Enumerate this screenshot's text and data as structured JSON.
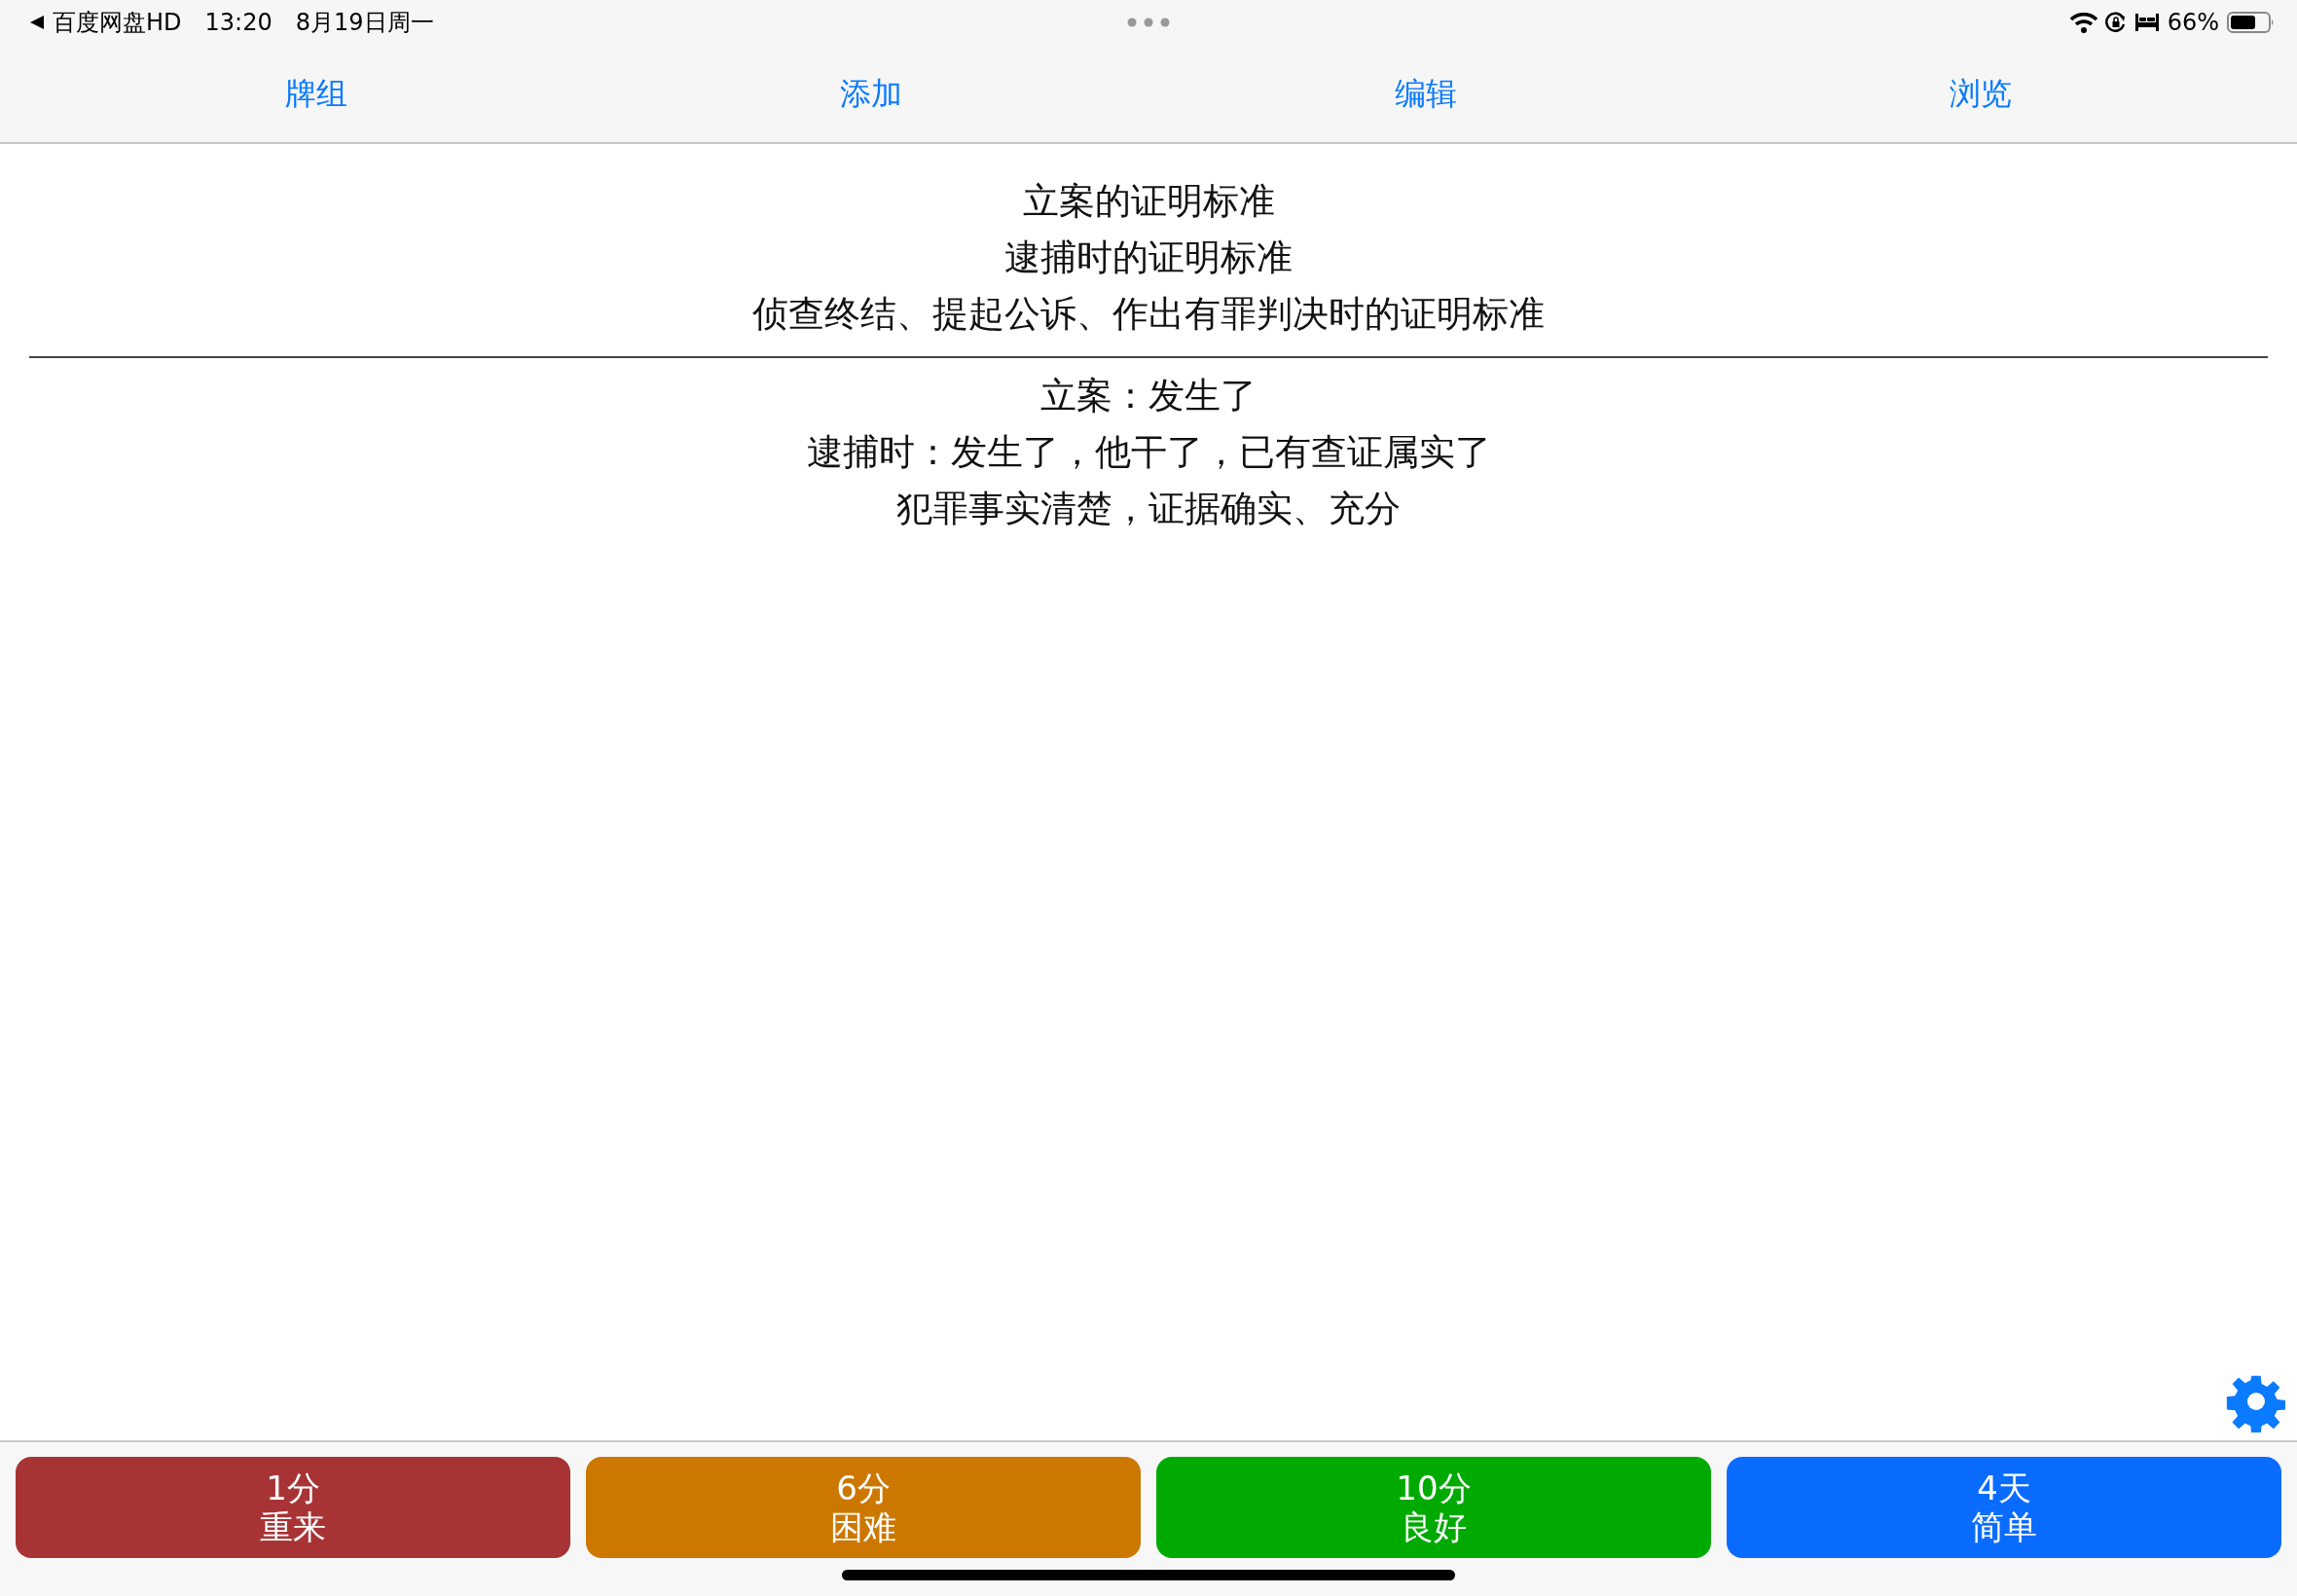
{
  "status_bar": {
    "back_app": "百度网盘HD",
    "time": "13:20",
    "date": "8月19日周一",
    "battery_percent": "66%"
  },
  "tabs": [
    {
      "label": "牌组"
    },
    {
      "label": "添加"
    },
    {
      "label": "编辑"
    },
    {
      "label": "浏览"
    }
  ],
  "card": {
    "question_lines": [
      "立案的证明标准",
      "逮捕时的证明标准",
      "侦查终结、提起公诉、作出有罪判决时的证明标准"
    ],
    "answer_lines": [
      "立案：发生了",
      "逮捕时：发生了，他干了，已有查证属实了",
      "犯罪事实清楚，证据确实、充分"
    ]
  },
  "answer_buttons": [
    {
      "interval": "1分",
      "label": "重来",
      "color": "#a83335"
    },
    {
      "interval": "6分",
      "label": "困难",
      "color": "#cc7700"
    },
    {
      "interval": "10分",
      "label": "良好",
      "color": "#00aa00"
    },
    {
      "interval": "4天",
      "label": "简单",
      "color": "#0a6cff"
    }
  ]
}
